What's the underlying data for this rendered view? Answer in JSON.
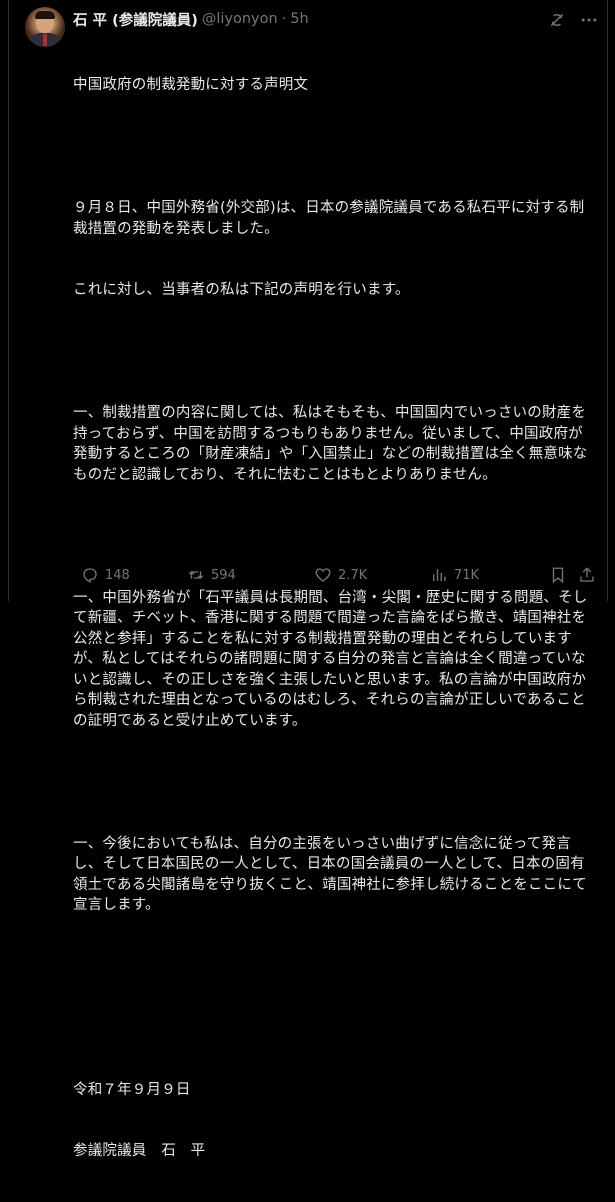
{
  "post": {
    "display_name": "石 平 (参議院議員)",
    "handle": "@liyonyon",
    "separator": "·",
    "time": "5h",
    "paragraphs": [
      "中国政府の制裁発動に対する声明文",
      "",
      "９月８日、中国外務省(外交部)は、日本の参議院議員である私石平に対する制裁措置の発動を発表しました。",
      "これに対し、当事者の私は下記の声明を行います。",
      "",
      "一、制裁措置の内容に関しては、私はそもそも、中国国内でいっさいの財産を持っておらず、中国を訪問するつもりもありません。従いまして、中国政府が発動するところの「財産凍結」や「入国禁止」などの制裁措置は全く無意味なものだと認識しており、それに怯むことはもとよりありません。",
      "",
      "一、中国外務省が「石平議員は長期間、台湾・尖閣・歴史に関する問題、そして新疆、チベット、香港に関する問題で間違った言論をばら撒き、靖国神社を公然と参拝」することを私に対する制裁措置発動の理由とそれらしていますが、私としてはそれらの諸問題に関する自分の発言と言論は全く間違っていないと認識し、その正しさを強く主張したいと思います。私の言論が中国政府から制裁された理由となっているのはむしろ、それらの言論が正しいであることの証明であると受け止めています。",
      "",
      "一、今後においても私は、自分の主張をいっさい曲げずに信念に従って発言し、そして日本国民の一人として、日本の国会議員の一人として、日本の固有領土である尖閣諸島を守り抜くこと、靖国神社に参拝し続けることをここにて宣言します。",
      "",
      "",
      "令和７年９月９日",
      "参議院議員　石　平"
    ]
  },
  "actions": {
    "reply_count": "148",
    "retweet_count": "594",
    "like_count": "2.7K",
    "views_count": "71K"
  },
  "icons": {
    "grok": "grok-icon",
    "more": "more-icon",
    "reply": "reply-icon",
    "retweet": "retweet-icon",
    "like": "heart-icon",
    "views": "views-icon",
    "bookmark": "bookmark-icon",
    "share": "share-icon"
  },
  "colors": {
    "background": "#000000",
    "text": "#e7e9ea",
    "muted": "#71767b",
    "border": "#2f3336"
  }
}
